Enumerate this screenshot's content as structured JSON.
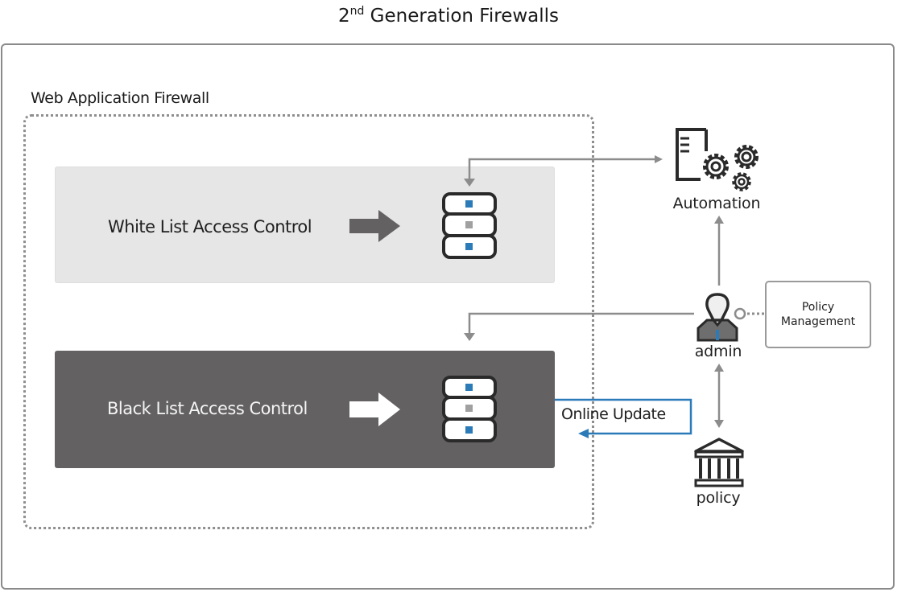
{
  "title": {
    "prefix": "2",
    "superscript": "nd",
    "main": " Generation Firewalls"
  },
  "waf": {
    "label": "Web Application Firewall"
  },
  "panels": {
    "white_list": {
      "label": "White List Access Control",
      "bg_color": "#e6e6e6",
      "arrow_color": "#636162"
    },
    "black_list": {
      "label": "Black List Access Control",
      "bg_color": "#636162",
      "arrow_color": "#ffffff"
    }
  },
  "nodes": {
    "automation": {
      "label": "Automation",
      "icon": "server-gears-icon"
    },
    "admin": {
      "label": "admin",
      "icon": "admin-user-icon"
    },
    "policy": {
      "label": "policy",
      "icon": "policy-building-icon"
    },
    "policy_management": {
      "line1": "Policy",
      "line2": "Management"
    }
  },
  "connectors": {
    "online_update": {
      "label": "Online Update",
      "color": "#2b7bb9"
    },
    "flow_color": "#8c8c8c"
  },
  "colors": {
    "accent_blue": "#2b7bb9",
    "indicator_gray": "#a0a0a0",
    "icon_dark": "#2a2a2a"
  }
}
